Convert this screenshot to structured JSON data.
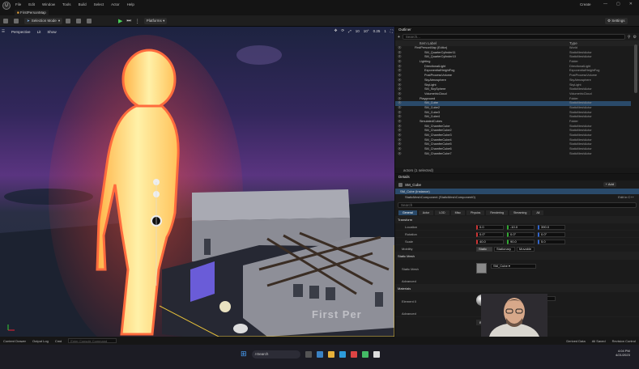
{
  "menubar": {
    "logo": "U",
    "items": [
      "File",
      "Edit",
      "Window",
      "Tools",
      "Build",
      "Select",
      "Actor",
      "Help"
    ],
    "right_label": "Create",
    "controls": [
      "—",
      "▢",
      "✕"
    ]
  },
  "tab": {
    "label": "FirstPersonMap"
  },
  "toolbar": {
    "selection_mode": "Selection Mode",
    "platforms": "Platforms",
    "settings": "Settings"
  },
  "viewport": {
    "perspective": "Perspective",
    "lit": "Lit",
    "show": "Show",
    "snap_values": [
      "10",
      "10°",
      "0.25",
      "1"
    ],
    "watermark": "First Per"
  },
  "outliner": {
    "tab_label": "Outliner",
    "search_placeholder": "Search...",
    "col_label": "Item Label",
    "col_type": "Type",
    "rows": [
      {
        "label": "FirstPersonMap (Editor)",
        "type": "World",
        "indent": 1
      },
      {
        "label": "SM_QuarterCylinder11",
        "type": "StaticMeshActor",
        "indent": 3
      },
      {
        "label": "SM_QuarterCylinder10",
        "type": "StaticMeshActor",
        "indent": 3
      },
      {
        "label": "Lighting",
        "type": "Folder",
        "indent": 2
      },
      {
        "label": "DirectionalLight",
        "type": "DirectionalLight",
        "indent": 3
      },
      {
        "label": "ExponentialHeightFog",
        "type": "ExponentialHeightFog",
        "indent": 3
      },
      {
        "label": "PostProcessVolume",
        "type": "PostProcessVolume",
        "indent": 3
      },
      {
        "label": "SkyAtmosphere",
        "type": "SkyAtmosphere",
        "indent": 3
      },
      {
        "label": "SkyLight",
        "type": "SkyLight",
        "indent": 3
      },
      {
        "label": "SM_SkySphere",
        "type": "StaticMeshActor",
        "indent": 3
      },
      {
        "label": "VolumetricCloud",
        "type": "VolumetricCloud",
        "indent": 3
      },
      {
        "label": "Playground",
        "type": "Folder",
        "indent": 2
      },
      {
        "label": "SM_Cube",
        "type": "StaticMeshActor",
        "indent": 3,
        "selected": true
      },
      {
        "label": "SM_Cube2",
        "type": "StaticMeshActor",
        "indent": 3
      },
      {
        "label": "SM_Cube3",
        "type": "StaticMeshActor",
        "indent": 3
      },
      {
        "label": "SM_Cube4",
        "type": "StaticMeshActor",
        "indent": 3
      },
      {
        "label": "SimulatedCubes",
        "type": "Folder",
        "indent": 2
      },
      {
        "label": "SM_ChamferCube",
        "type": "StaticMeshActor",
        "indent": 3
      },
      {
        "label": "SM_ChamferCube2",
        "type": "StaticMeshActor",
        "indent": 3
      },
      {
        "label": "SM_ChamferCube3",
        "type": "StaticMeshActor",
        "indent": 3
      },
      {
        "label": "SM_ChamferCube4",
        "type": "StaticMeshActor",
        "indent": 3
      },
      {
        "label": "SM_ChamferCube5",
        "type": "StaticMeshActor",
        "indent": 3
      },
      {
        "label": "SM_ChamferCube6",
        "type": "StaticMeshActor",
        "indent": 3
      },
      {
        "label": "SM_ChamferCube7",
        "type": "StaticMeshActor",
        "indent": 3
      }
    ],
    "actor_count": "actors (1 selected)"
  },
  "details": {
    "tab_label": "Details",
    "actor_name": "SM_Cube",
    "add_label": "+ Add",
    "component_root": "SM_Cube (Instance)",
    "component_child": "StaticMeshComponent (StaticMeshComponent0)",
    "edit_link": "Edit in C++",
    "search_placeholder": "Search",
    "filter_tabs": [
      "General",
      "Actor",
      "LOD",
      "Misc",
      "Physics",
      "Rendering",
      "Streaming",
      "All"
    ],
    "transform_header": "Transform",
    "location": {
      "label": "Location",
      "x": "0.0",
      "y": "-10.0",
      "z": "390.0"
    },
    "rotation": {
      "label": "Rotation",
      "x": "0.0°",
      "y": "0.0°",
      "z": "0.0°"
    },
    "scale": {
      "label": "Scale",
      "x": "40.0",
      "y": "90.0",
      "z": "5.0"
    },
    "mobility": {
      "label": "Mobility",
      "options": [
        "Static",
        "Stationary",
        "Movable"
      ]
    },
    "static_mesh_header": "Static Mesh",
    "static_mesh_label": "Static Mesh",
    "static_mesh_value": "SM_Cube",
    "advanced": "Advanced",
    "materials_header": "Materials",
    "element_label": "Element 0",
    "browse_label": "Browse"
  },
  "bottombar": {
    "content_drawer": "Content Drawer",
    "output_log": "Output Log",
    "cmd": "Cmd",
    "cmd_placeholder": "Enter Console Command",
    "derived_data": "Derived Data",
    "all_saved": "All Saved",
    "revision_control": "Revision Control"
  },
  "taskbar": {
    "search": "Search",
    "time": "4:04 PM",
    "date": "4/21/2023"
  }
}
